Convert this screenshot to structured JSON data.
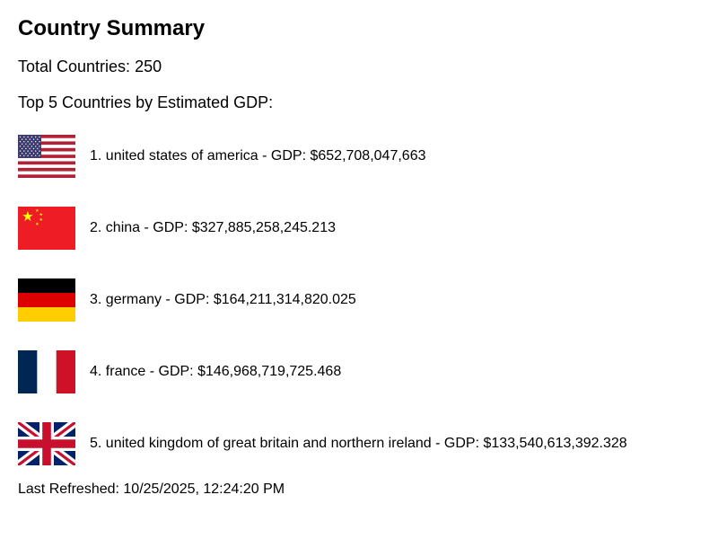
{
  "header": {
    "title": "Country Summary"
  },
  "summary": {
    "total_label": "Total Countries:",
    "total_value": "250",
    "top_heading": "Top 5 Countries by Estimated GDP:"
  },
  "countries": [
    {
      "rank": "1.",
      "name": "united states of america",
      "gdp_label": "- GDP:",
      "gdp": "$652,708,047,663",
      "flag_icon": "us-flag-icon"
    },
    {
      "rank": "2.",
      "name": "china",
      "gdp_label": "- GDP:",
      "gdp": "$327,885,258,245.213",
      "flag_icon": "china-flag-icon"
    },
    {
      "rank": "3.",
      "name": "germany",
      "gdp_label": "- GDP:",
      "gdp": "$164,211,314,820.025",
      "flag_icon": "germany-flag-icon"
    },
    {
      "rank": "4.",
      "name": "france",
      "gdp_label": "- GDP:",
      "gdp": "$146,968,719,725.468",
      "flag_icon": "france-flag-icon"
    },
    {
      "rank": "5.",
      "name": "united kingdom of great britain and northern ireland",
      "gdp_label": "- GDP:",
      "gdp": "$133,540,613,392.328",
      "flag_icon": "uk-flag-icon"
    }
  ],
  "footer": {
    "refreshed_label": "Last Refreshed:",
    "refreshed_value": "10/25/2025, 12:24:20 PM"
  },
  "colors": {
    "text": "#000000",
    "background": "#ffffff",
    "us_red": "#b22234",
    "us_blue": "#3c3b6e",
    "china_red": "#ee1c25",
    "china_yellow": "#ffff00",
    "germany_black": "#000000",
    "germany_red": "#dd0000",
    "germany_gold": "#ffce00",
    "france_blue": "#002654",
    "france_red": "#ce1126",
    "uk_blue": "#012169",
    "uk_red": "#c8102e"
  }
}
